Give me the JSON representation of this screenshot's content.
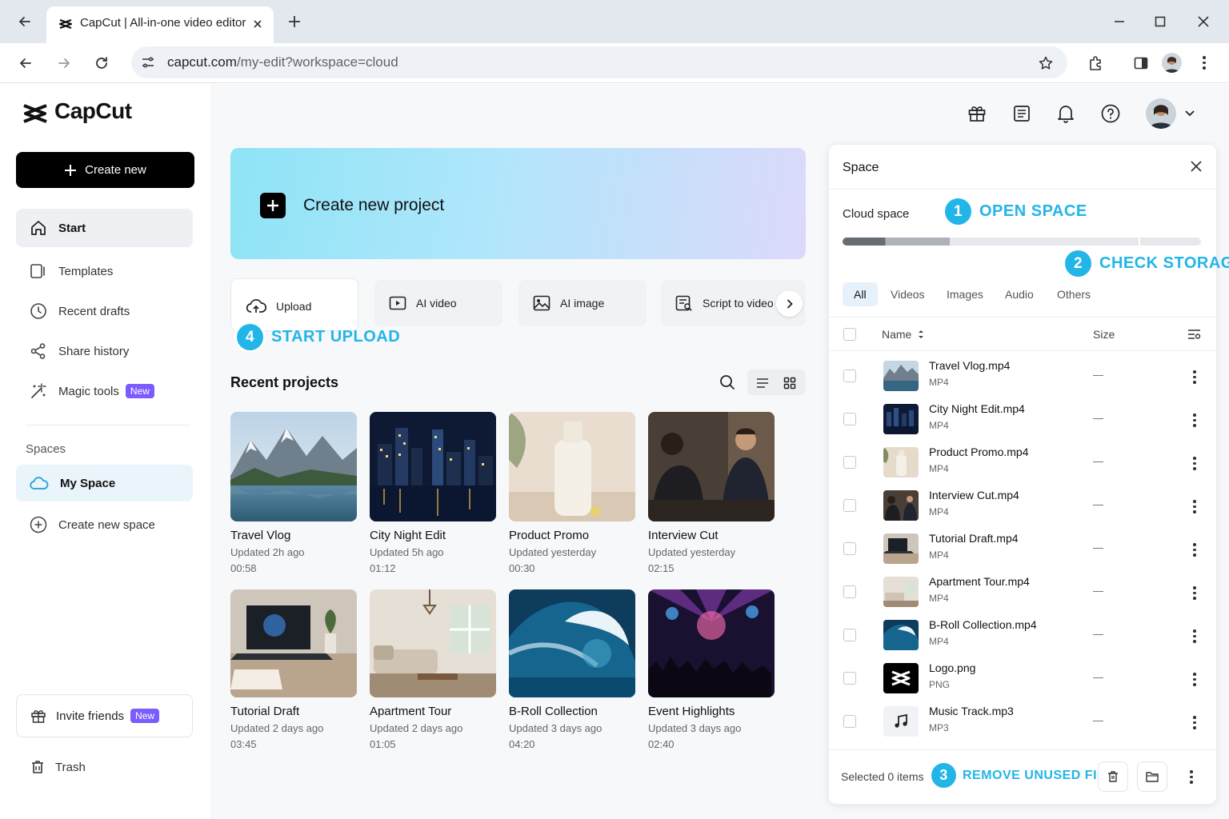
{
  "browser": {
    "tab_title": "CapCut | All-in-one video editor",
    "url_host": "capcut.com",
    "url_path": "/my-edit?workspace=cloud"
  },
  "brand": {
    "name": "CapCut"
  },
  "sidebar": {
    "create_new": "Create new",
    "items": [
      {
        "label": "Start"
      },
      {
        "label": "Templates"
      },
      {
        "label": "Recent drafts"
      },
      {
        "label": "Share history"
      },
      {
        "label": "Magic tools",
        "badge": "New"
      }
    ],
    "spaces_title": "Spaces",
    "my_space": "My Space",
    "create_space": "Create new space",
    "invite": "Invite friends",
    "invite_badge": "New",
    "trash": "Trash"
  },
  "hero": {
    "label": "Create new project"
  },
  "tools": {
    "upload": "Upload",
    "ai_video": "AI video",
    "ai_image": "AI image",
    "script": "Script to video"
  },
  "callouts": {
    "open_space": {
      "num": "1",
      "text": "OPEN SPACE"
    },
    "check_storage": {
      "num": "2",
      "text": "CHECK STORAGE"
    },
    "remove_files": {
      "num": "3",
      "text": "REMOVE UNUSED FILES"
    },
    "start_upload": {
      "num": "4",
      "text": "START UPLOAD"
    }
  },
  "recent": {
    "title": "Recent projects",
    "projects": [
      {
        "name": "Travel Vlog",
        "updated": "Updated 2h ago",
        "duration": "00:58"
      },
      {
        "name": "City Night Edit",
        "updated": "Updated 5h ago",
        "duration": "01:12"
      },
      {
        "name": "Product Promo",
        "updated": "Updated yesterday",
        "duration": "00:30"
      },
      {
        "name": "Interview Cut",
        "updated": "Updated yesterday",
        "duration": "02:15"
      },
      {
        "name": "Tutorial Draft",
        "updated": "Updated 2 days ago",
        "duration": "03:45"
      },
      {
        "name": "Apartment Tour",
        "updated": "Updated 2 days ago",
        "duration": "01:05"
      },
      {
        "name": "B-Roll Collection",
        "updated": "Updated 3 days ago",
        "duration": "04:20"
      },
      {
        "name": "Event Highlights",
        "updated": "Updated 3 days ago",
        "duration": "02:40"
      }
    ]
  },
  "space_panel": {
    "title": "Space",
    "cloud_space": "Cloud space",
    "storage_used_fraction": 0.3,
    "filters": [
      "All",
      "Videos",
      "Images",
      "Audio",
      "Others"
    ],
    "active_filter": "All",
    "col_name": "Name",
    "col_size": "Size",
    "files": [
      {
        "name": "Travel Vlog.mp4",
        "type": "MP4",
        "size": "—"
      },
      {
        "name": "City Night Edit.mp4",
        "type": "MP4",
        "size": "—"
      },
      {
        "name": "Product Promo.mp4",
        "type": "MP4",
        "size": "—"
      },
      {
        "name": "Interview Cut.mp4",
        "type": "MP4",
        "size": "—"
      },
      {
        "name": "Tutorial Draft.mp4",
        "type": "MP4",
        "size": "—"
      },
      {
        "name": "Apartment Tour.mp4",
        "type": "MP4",
        "size": "—"
      },
      {
        "name": "B-Roll Collection.mp4",
        "type": "MP4",
        "size": "—"
      },
      {
        "name": "Logo.png",
        "type": "PNG",
        "size": "—"
      },
      {
        "name": "Music Track.mp3",
        "type": "MP3",
        "size": "—"
      }
    ],
    "selected": "Selected 0 items"
  },
  "colors": {
    "accent": "#22b5e8",
    "badge": "#7c5cff"
  }
}
